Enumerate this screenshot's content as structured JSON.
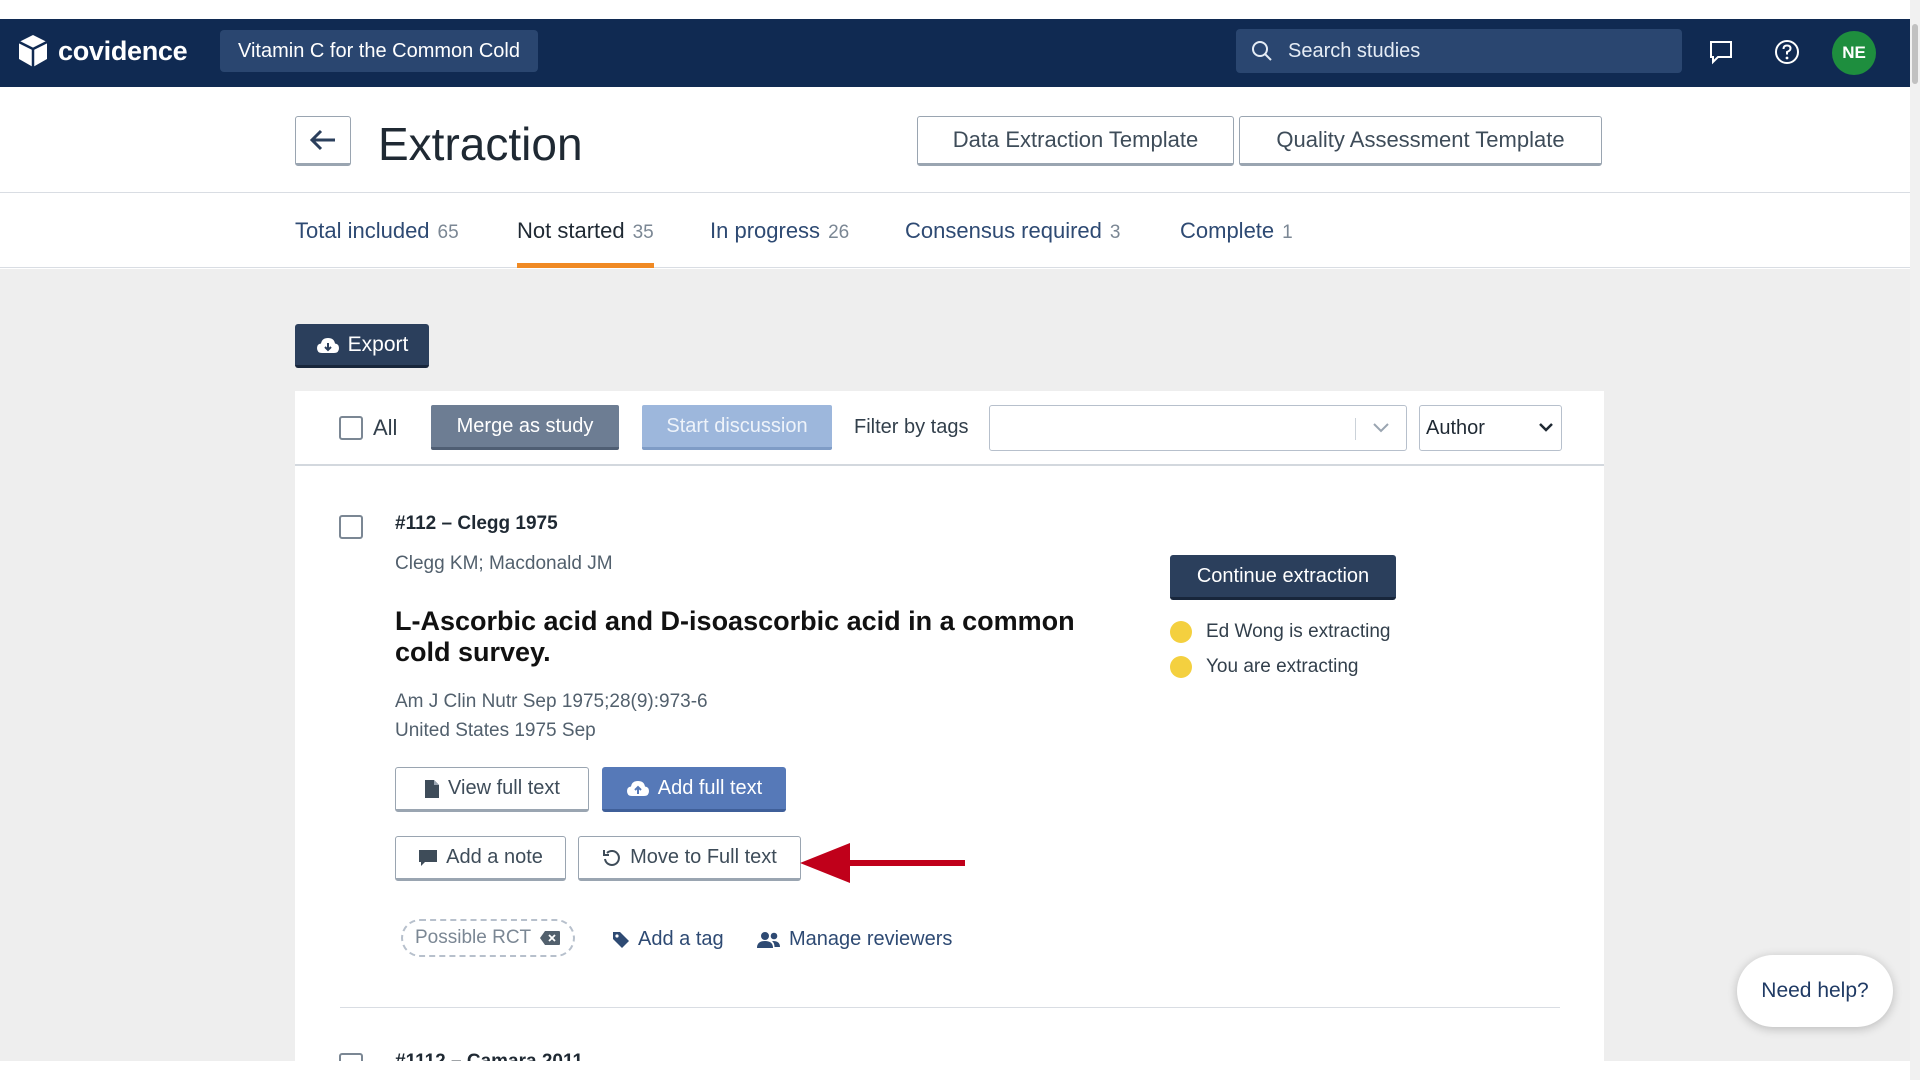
{
  "brand": {
    "name": "covidence"
  },
  "project": {
    "name": "Vitamin C for the Common Cold"
  },
  "search": {
    "placeholder": "Search studies"
  },
  "user": {
    "initials": "NE"
  },
  "header": {
    "title": "Extraction",
    "data_template_label": "Data Extraction Template",
    "quality_template_label": "Quality Assessment Template"
  },
  "tabs": [
    {
      "label": "Total included",
      "count": "65"
    },
    {
      "label": "Not started",
      "count": "35"
    },
    {
      "label": "In progress",
      "count": "26"
    },
    {
      "label": "Consensus required",
      "count": "3"
    },
    {
      "label": "Complete",
      "count": "1"
    }
  ],
  "toolbar": {
    "export_label": "Export",
    "all_label": "All",
    "merge_label": "Merge as study",
    "discussion_label": "Start discussion",
    "filter_label": "Filter by tags",
    "sort_value": "Author"
  },
  "study": {
    "id_line": "#112 – Clegg 1975",
    "authors": "Clegg KM; Macdonald JM",
    "title": "L-Ascorbic acid and D-isoascorbic acid in a common cold survey.",
    "journal": "Am J Clin Nutr Sep 1975;28(9):973-6",
    "country": "United States 1975 Sep",
    "view_full_text_label": "View full text",
    "add_full_text_label": "Add full text",
    "add_note_label": "Add a note",
    "move_label": "Move to Full text",
    "tag": "Possible RCT",
    "add_tag_label": "Add a tag",
    "manage_reviewers_label": "Manage reviewers",
    "continue_label": "Continue extraction",
    "statuses": [
      "Ed Wong is extracting",
      "You are extracting"
    ]
  },
  "next_study": {
    "id_line": "#1112 – Camara 2011"
  },
  "help": {
    "label": "Need help?"
  },
  "colors": {
    "nav": "#102a52",
    "accent_tab": "#f08a24",
    "status_dot": "#f4d03f",
    "arrow": "#c0001a"
  }
}
